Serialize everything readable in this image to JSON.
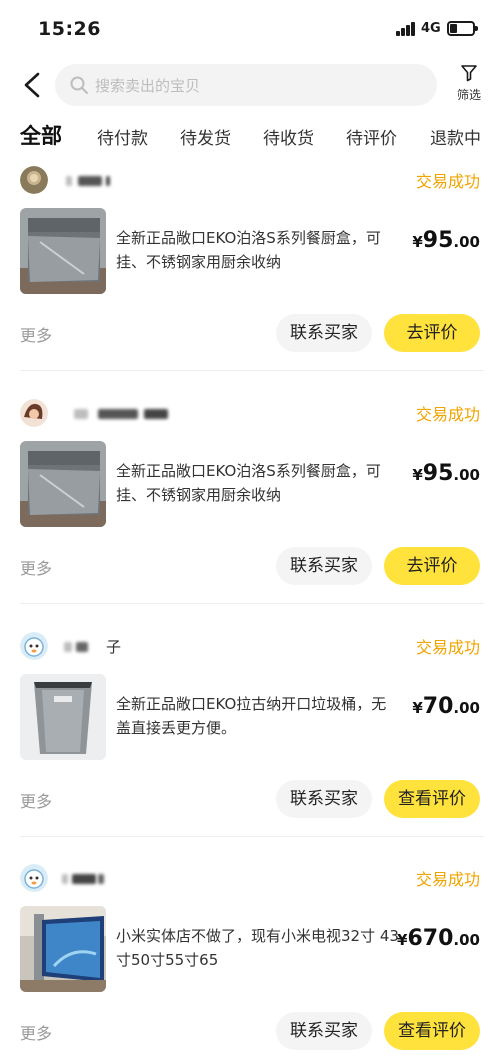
{
  "status_bar": {
    "time": "15:26",
    "network": "4G"
  },
  "header": {
    "search_placeholder": "搜索卖出的宝贝",
    "filter_label": "筛选"
  },
  "tabs": [
    {
      "label": "全部",
      "active": true
    },
    {
      "label": "待付款"
    },
    {
      "label": "待发货"
    },
    {
      "label": "待收货"
    },
    {
      "label": "待评价"
    },
    {
      "label": "退款中"
    }
  ],
  "orders": [
    {
      "seller_suffix": "",
      "status": "交易成功",
      "product_title": "全新正品敞口EKO泊洛S系列餐厨盒，可挂、不锈钢家用厨余收纳",
      "price_currency": "¥",
      "price_int": "95",
      "price_dec": ".00",
      "more_label": "更多",
      "contact_label": "联系买家",
      "action_label": "去评价"
    },
    {
      "seller_suffix": "",
      "status": "交易成功",
      "product_title": "全新正品敞口EKO泊洛S系列餐厨盒，可挂、不锈钢家用厨余收纳",
      "price_currency": "¥",
      "price_int": "95",
      "price_dec": ".00",
      "more_label": "更多",
      "contact_label": "联系买家",
      "action_label": "去评价"
    },
    {
      "seller_suffix": "子",
      "status": "交易成功",
      "product_title": "全新正品敞口EKO拉古纳开口垃圾桶，无盖直接丢更方便。",
      "price_currency": "¥",
      "price_int": "70",
      "price_dec": ".00",
      "more_label": "更多",
      "contact_label": "联系买家",
      "action_label": "查看评价"
    },
    {
      "seller_suffix": "",
      "status": "交易成功",
      "product_title": "小米实体店不做了，现有小米电视32寸 43寸50寸55寸65",
      "price_currency": "¥",
      "price_int": "670",
      "price_dec": ".00",
      "more_label": "更多",
      "contact_label": "联系买家",
      "action_label": "查看评价"
    }
  ],
  "colors": {
    "accent": "#ffe23c",
    "status": "#f0a400",
    "muted": "#9a9a9a"
  }
}
